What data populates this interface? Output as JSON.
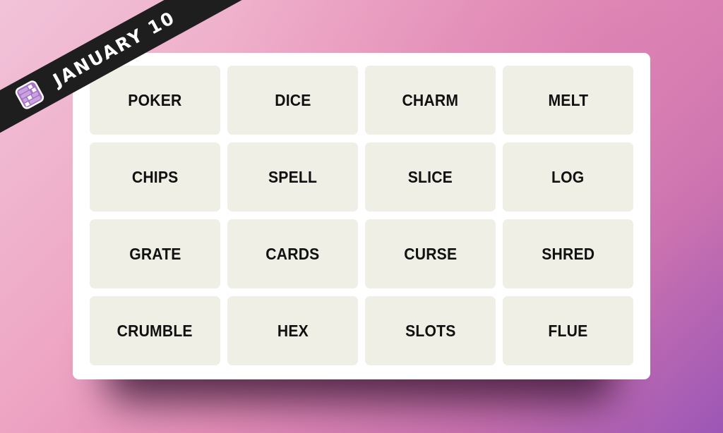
{
  "banner": {
    "date_label": "JANUARY 10",
    "icon": "connections-grid-icon",
    "colors": {
      "band": "#1e1e1e",
      "icon_purple": "#a874c8",
      "text": "#ffffff"
    }
  },
  "board": {
    "tile_color": "#efefe6",
    "text_color": "#111111",
    "rows": [
      [
        "POKER",
        "DICE",
        "CHARM",
        "MELT"
      ],
      [
        "CHIPS",
        "SPELL",
        "SLICE",
        "LOG"
      ],
      [
        "GRATE",
        "CARDS",
        "CURSE",
        "SHRED"
      ],
      [
        "CRUMBLE",
        "HEX",
        "SLOTS",
        "FLUE"
      ]
    ]
  },
  "background": {
    "gradient_from": "#f1c3d9",
    "gradient_to": "#9c56b6"
  }
}
